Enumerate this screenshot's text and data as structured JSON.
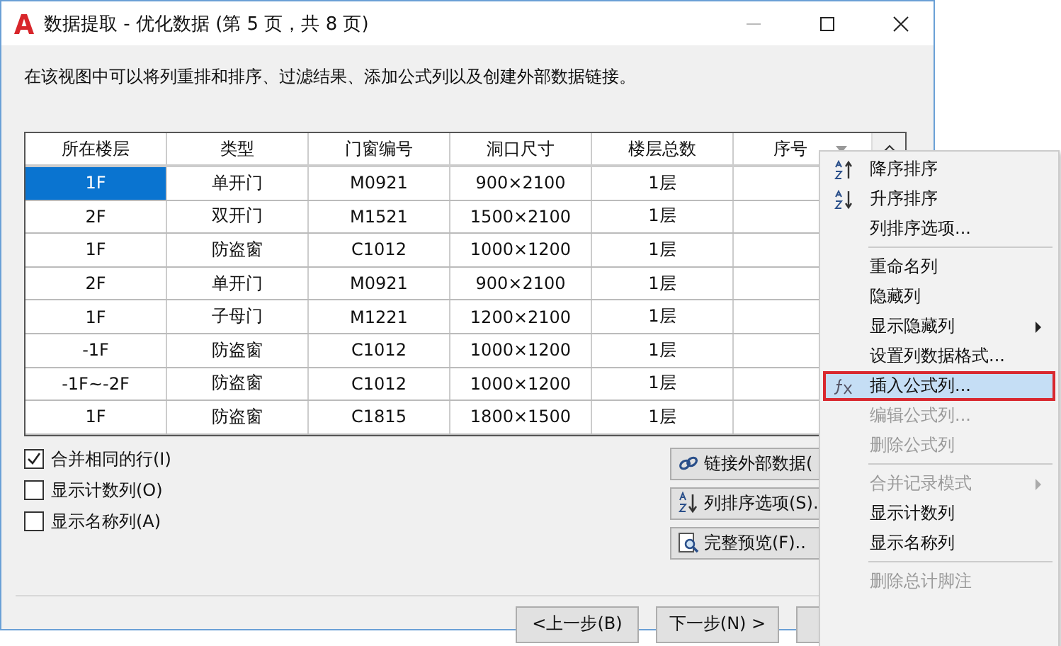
{
  "window": {
    "title": "数据提取 - 优化数据 (第 5 页，共 8 页)"
  },
  "description": "在该视图中可以将列重排和排序、过滤结果、添加公式列以及创建外部数据链接。",
  "table": {
    "columns": [
      "所在楼层",
      "类型",
      "门窗编号",
      "洞口尺寸",
      "楼层总数",
      "序号"
    ],
    "rows": [
      {
        "selected": true,
        "cells": [
          "1F",
          "单开门",
          "M0921",
          "900×2100",
          "1层"
        ]
      },
      {
        "selected": false,
        "cells": [
          "2F",
          "双开门",
          "M1521",
          "1500×2100",
          "1层"
        ]
      },
      {
        "selected": false,
        "cells": [
          "1F",
          "防盗窗",
          "C1012",
          "1000×1200",
          "1层"
        ]
      },
      {
        "selected": false,
        "cells": [
          "2F",
          "单开门",
          "M0921",
          "900×2100",
          "1层"
        ]
      },
      {
        "selected": false,
        "cells": [
          "1F",
          "子母门",
          "M1221",
          "1200×2100",
          "1层"
        ]
      },
      {
        "selected": false,
        "cells": [
          "-1F",
          "防盗窗",
          "C1012",
          "1000×1200",
          "1层"
        ]
      },
      {
        "selected": false,
        "cells": [
          "-1F~-2F",
          "防盗窗",
          "C1012",
          "1000×1200",
          "1层"
        ]
      },
      {
        "selected": false,
        "cells": [
          "1F",
          "防盗窗",
          "C1815",
          "1800×1500",
          "1层"
        ]
      }
    ]
  },
  "options": [
    {
      "label": "合并相同的行(I)",
      "checked": true
    },
    {
      "label": "显示计数列(O)",
      "checked": false
    },
    {
      "label": "显示名称列(A)",
      "checked": false
    }
  ],
  "side_buttons": [
    {
      "label": "链接外部数据("
    },
    {
      "label": "列排序选项(S)."
    },
    {
      "label": "完整预览(F).."
    }
  ],
  "nav_buttons": [
    "<上一步(B)",
    "下一步(N) >"
  ],
  "context_menu": [
    {
      "kind": "item",
      "label": "降序排序",
      "disabled": false,
      "submenu": false,
      "selected": false
    },
    {
      "kind": "item",
      "label": "升序排序",
      "disabled": false,
      "submenu": false,
      "selected": false
    },
    {
      "kind": "item",
      "label": "列排序选项...",
      "disabled": false,
      "submenu": false,
      "selected": false
    },
    {
      "kind": "separator"
    },
    {
      "kind": "item",
      "label": "重命名列",
      "disabled": false,
      "submenu": false,
      "selected": false
    },
    {
      "kind": "item",
      "label": "隐藏列",
      "disabled": false,
      "submenu": false,
      "selected": false
    },
    {
      "kind": "item",
      "label": "显示隐藏列",
      "disabled": false,
      "submenu": true,
      "selected": false
    },
    {
      "kind": "item",
      "label": "设置列数据格式...",
      "disabled": false,
      "submenu": false,
      "selected": false
    },
    {
      "kind": "item",
      "label": "插入公式列...",
      "disabled": false,
      "submenu": false,
      "selected": true
    },
    {
      "kind": "item",
      "label": "编辑公式列...",
      "disabled": true,
      "submenu": false,
      "selected": false
    },
    {
      "kind": "item",
      "label": "删除公式列",
      "disabled": true,
      "submenu": false,
      "selected": false
    },
    {
      "kind": "separator"
    },
    {
      "kind": "item",
      "label": "合并记录模式",
      "disabled": true,
      "submenu": true,
      "selected": false
    },
    {
      "kind": "item",
      "label": "显示计数列",
      "disabled": false,
      "submenu": false,
      "selected": false
    },
    {
      "kind": "item",
      "label": "显示名称列",
      "disabled": false,
      "submenu": false,
      "selected": false
    },
    {
      "kind": "separator"
    },
    {
      "kind": "item",
      "label": "删除总计脚注",
      "disabled": true,
      "submenu": false,
      "selected": false
    }
  ]
}
